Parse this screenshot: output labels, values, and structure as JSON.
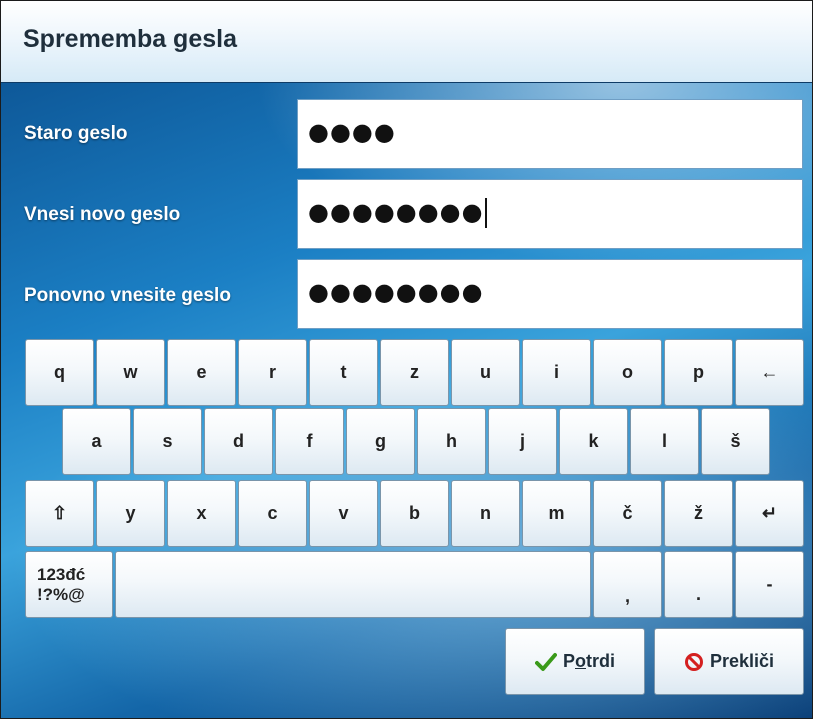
{
  "window": {
    "title": "Sprememba gesla"
  },
  "form": {
    "fields": [
      {
        "label": "Staro geslo",
        "value": "●●●●"
      },
      {
        "label": "Vnesi novo geslo",
        "value": "●●●●●●●●"
      },
      {
        "label": "Ponovno vnesite geslo",
        "value": "●●●●●●●●"
      }
    ]
  },
  "keyboard": {
    "row1": [
      "q",
      "w",
      "e",
      "r",
      "t",
      "z",
      "u",
      "i",
      "o",
      "p",
      "←"
    ],
    "row2": [
      "a",
      "s",
      "d",
      "f",
      "g",
      "h",
      "j",
      "k",
      "l",
      "š"
    ],
    "row3": [
      "⇧",
      "y",
      "x",
      "c",
      "v",
      "b",
      "n",
      "m",
      "č",
      "ž",
      "↵"
    ],
    "row4": {
      "mode_line1": "123đć",
      "mode_line2": "!?%@",
      "comma": ",",
      "period": ".",
      "dash": "-"
    }
  },
  "buttons": {
    "confirm": {
      "label_pre": "P",
      "label_u": "o",
      "label_post": "trdi",
      "icon": "checkmark-icon",
      "color": "#3a9a1a"
    },
    "cancel": {
      "label": "Prekliči",
      "icon": "prohibited-icon",
      "color": "#d42020"
    }
  }
}
